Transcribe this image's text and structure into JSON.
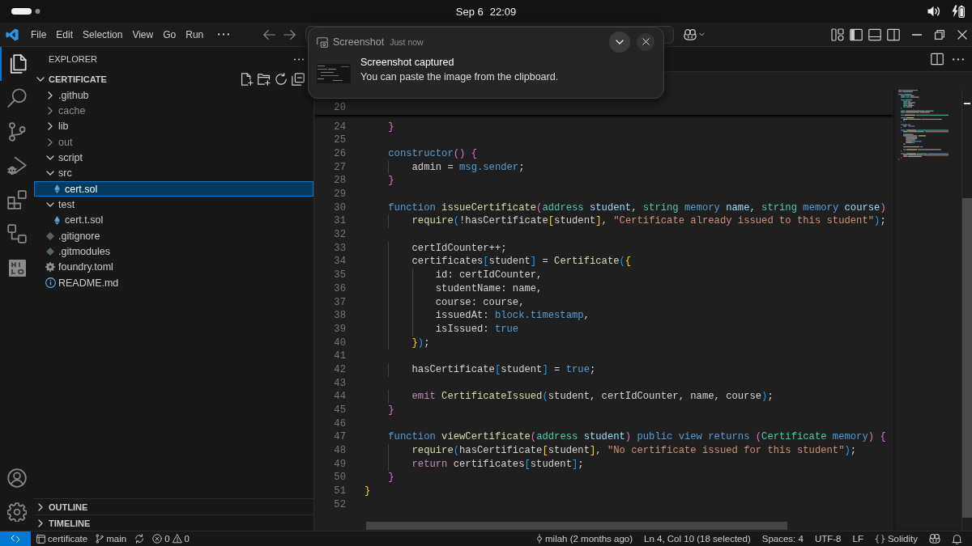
{
  "top_bar": {
    "date": "Sep 6",
    "time": "22:09"
  },
  "title_bar": {
    "menu": [
      "File",
      "Edit",
      "Selection",
      "View",
      "Go",
      "Run"
    ]
  },
  "activity_bar": {
    "items": [
      {
        "kind": "explorer",
        "selected": true
      },
      {
        "kind": "search",
        "selected": false
      },
      {
        "kind": "source-control",
        "selected": false
      },
      {
        "kind": "run-debug",
        "selected": false
      },
      {
        "kind": "extensions",
        "selected": false
      },
      {
        "kind": "remote",
        "selected": false
      },
      {
        "kind": "extension-tile",
        "selected": false
      }
    ],
    "bottom": [
      {
        "kind": "account"
      },
      {
        "kind": "settings"
      }
    ]
  },
  "explorer": {
    "title": "EXPLORER",
    "folder": {
      "name": "CERTIFICATE",
      "expanded": true,
      "children": [
        {
          "name": ".github",
          "kind": "folder",
          "expanded": false,
          "ignored": false,
          "selected": false
        },
        {
          "name": "cache",
          "kind": "folder",
          "expanded": false,
          "ignored": true,
          "selected": false
        },
        {
          "name": "lib",
          "kind": "folder",
          "expanded": false,
          "ignored": false,
          "selected": false
        },
        {
          "name": "out",
          "kind": "folder",
          "expanded": false,
          "ignored": true,
          "selected": false
        },
        {
          "name": "script",
          "kind": "folder",
          "expanded": true,
          "ignored": false,
          "selected": false
        },
        {
          "name": "src",
          "kind": "folder",
          "expanded": true,
          "ignored": false,
          "selected": false,
          "children": [
            {
              "name": "cert.sol",
              "kind": "solidity",
              "ignored": false,
              "selected": true
            }
          ]
        },
        {
          "name": "test",
          "kind": "folder",
          "expanded": true,
          "ignored": false,
          "selected": false,
          "children": [
            {
              "name": "cert.t.sol",
              "kind": "solidity",
              "ignored": false,
              "selected": false
            }
          ]
        },
        {
          "name": ".gitignore",
          "kind": "git",
          "ignored": false,
          "selected": false
        },
        {
          "name": ".gitmodules",
          "kind": "git",
          "ignored": false,
          "selected": false
        },
        {
          "name": "foundry.toml",
          "kind": "config",
          "ignored": false,
          "selected": false
        },
        {
          "name": "README.md",
          "kind": "info",
          "ignored": false,
          "selected": false
        }
      ]
    },
    "sections": [
      {
        "name": "OUTLINE",
        "expanded": false
      },
      {
        "name": "TIMELINE",
        "expanded": false
      }
    ]
  },
  "notification": {
    "app": "Screenshot",
    "time": "Just now",
    "title": "Screenshot captured",
    "body": "You can paste the image from the clipboard."
  },
  "editor": {
    "sticky_line": {
      "number": "20"
    },
    "lines": [
      {
        "number": "24",
        "tokens": [
          {
            "text": "    }",
            "kind": "b2"
          }
        ]
      },
      {
        "number": "25"
      },
      {
        "number": "26",
        "tokens": [
          {
            "text": "    constructor",
            "kind": "kw"
          },
          {
            "text": "()",
            "kind": "b2"
          },
          {
            "text": " {",
            "kind": "b2"
          }
        ]
      },
      {
        "number": "27",
        "tokens": [
          {
            "text": "        admin = ",
            "kind": "txt"
          },
          {
            "text": "msg.sender",
            "kind": "kw"
          },
          {
            "text": ";",
            "kind": "txt"
          }
        ]
      },
      {
        "number": "28",
        "tokens": [
          {
            "text": "    }",
            "kind": "b2"
          }
        ]
      },
      {
        "number": "29"
      },
      {
        "number": "30",
        "tokens": [
          {
            "text": "    function",
            "kind": "kw"
          },
          {
            "text": " issueCertificate",
            "kind": "fn"
          },
          {
            "text": "(",
            "kind": "b2"
          },
          {
            "text": "address",
            "kind": "type"
          },
          {
            "text": " student",
            "kind": "var"
          },
          {
            "text": ", ",
            "kind": "txt"
          },
          {
            "text": "string",
            "kind": "type"
          },
          {
            "text": " memory",
            "kind": "kw"
          },
          {
            "text": " name",
            "kind": "var"
          },
          {
            "text": ", ",
            "kind": "txt"
          },
          {
            "text": "string",
            "kind": "type"
          },
          {
            "text": " memory",
            "kind": "kw"
          },
          {
            "text": " course",
            "kind": "var"
          },
          {
            "text": ")",
            "kind": "b2"
          }
        ]
      },
      {
        "number": "31",
        "tokens": [
          {
            "text": "        require",
            "kind": "fn"
          },
          {
            "text": "(",
            "kind": "b3"
          },
          {
            "text": "!hasCertificate",
            "kind": "txt"
          },
          {
            "text": "[",
            "kind": "b1"
          },
          {
            "text": "student",
            "kind": "txt"
          },
          {
            "text": "]",
            "kind": "b1"
          },
          {
            "text": ", ",
            "kind": "txt"
          },
          {
            "text": "\"Certificate already issued to this student\"",
            "kind": "str"
          },
          {
            "text": ")",
            "kind": "b3"
          },
          {
            "text": ";",
            "kind": "txt"
          }
        ]
      },
      {
        "number": "32"
      },
      {
        "number": "33",
        "tokens": [
          {
            "text": "        certIdCounter++;",
            "kind": "txt"
          }
        ]
      },
      {
        "number": "34",
        "tokens": [
          {
            "text": "        certificates",
            "kind": "txt"
          },
          {
            "text": "[",
            "kind": "b3"
          },
          {
            "text": "student",
            "kind": "txt"
          },
          {
            "text": "]",
            "kind": "b3"
          },
          {
            "text": " = ",
            "kind": "txt"
          },
          {
            "text": "Certificate",
            "kind": "fn"
          },
          {
            "text": "(",
            "kind": "b3"
          },
          {
            "text": "{",
            "kind": "b1"
          }
        ]
      },
      {
        "number": "35",
        "tokens": [
          {
            "text": "            id: certIdCounter,",
            "kind": "txt"
          }
        ]
      },
      {
        "number": "36",
        "tokens": [
          {
            "text": "            studentName: name,",
            "kind": "txt"
          }
        ]
      },
      {
        "number": "37",
        "tokens": [
          {
            "text": "            course: course,",
            "kind": "txt"
          }
        ]
      },
      {
        "number": "38",
        "tokens": [
          {
            "text": "            issuedAt: ",
            "kind": "txt"
          },
          {
            "text": "block.timestamp",
            "kind": "kw"
          },
          {
            "text": ",",
            "kind": "txt"
          }
        ]
      },
      {
        "number": "39",
        "tokens": [
          {
            "text": "            isIssued: ",
            "kind": "txt"
          },
          {
            "text": "true",
            "kind": "kw"
          }
        ]
      },
      {
        "number": "40",
        "tokens": [
          {
            "text": "        }",
            "kind": "b1"
          },
          {
            "text": ")",
            "kind": "b3"
          },
          {
            "text": ";",
            "kind": "txt"
          }
        ]
      },
      {
        "number": "41"
      },
      {
        "number": "42",
        "tokens": [
          {
            "text": "        hasCertificate",
            "kind": "txt"
          },
          {
            "text": "[",
            "kind": "b3"
          },
          {
            "text": "student",
            "kind": "txt"
          },
          {
            "text": "]",
            "kind": "b3"
          },
          {
            "text": " = ",
            "kind": "txt"
          },
          {
            "text": "true",
            "kind": "kw"
          },
          {
            "text": ";",
            "kind": "txt"
          }
        ]
      },
      {
        "number": "43"
      },
      {
        "number": "44",
        "tokens": [
          {
            "text": "        emit",
            "kind": "ctl"
          },
          {
            "text": " CertificateIssued",
            "kind": "fn"
          },
          {
            "text": "(",
            "kind": "b3"
          },
          {
            "text": "student, certIdCounter, name, course",
            "kind": "txt"
          },
          {
            "text": ")",
            "kind": "b3"
          },
          {
            "text": ";",
            "kind": "txt"
          }
        ]
      },
      {
        "number": "45",
        "tokens": [
          {
            "text": "    }",
            "kind": "b2"
          }
        ]
      },
      {
        "number": "46"
      },
      {
        "number": "47",
        "tokens": [
          {
            "text": "    function",
            "kind": "kw"
          },
          {
            "text": " viewCertificate",
            "kind": "fn"
          },
          {
            "text": "(",
            "kind": "b2"
          },
          {
            "text": "address",
            "kind": "type"
          },
          {
            "text": " student",
            "kind": "var"
          },
          {
            "text": ")",
            "kind": "b2"
          },
          {
            "text": " public view returns",
            "kind": "kw"
          },
          {
            "text": " (",
            "kind": "b2"
          },
          {
            "text": "Certificate",
            "kind": "type"
          },
          {
            "text": " memory",
            "kind": "kw"
          },
          {
            "text": ")",
            "kind": "b2"
          },
          {
            "text": " {",
            "kind": "b2"
          }
        ]
      },
      {
        "number": "48",
        "tokens": [
          {
            "text": "        require",
            "kind": "fn"
          },
          {
            "text": "(",
            "kind": "b3"
          },
          {
            "text": "hasCertificate",
            "kind": "txt"
          },
          {
            "text": "[",
            "kind": "b1"
          },
          {
            "text": "student",
            "kind": "txt"
          },
          {
            "text": "]",
            "kind": "b1"
          },
          {
            "text": ", ",
            "kind": "txt"
          },
          {
            "text": "\"No certificate issued for this student\"",
            "kind": "str"
          },
          {
            "text": ")",
            "kind": "b3"
          },
          {
            "text": ";",
            "kind": "txt"
          }
        ]
      },
      {
        "number": "49",
        "tokens": [
          {
            "text": "        return",
            "kind": "ctl"
          },
          {
            "text": " certificates",
            "kind": "txt"
          },
          {
            "text": "[",
            "kind": "b3"
          },
          {
            "text": "student",
            "kind": "txt"
          },
          {
            "text": "]",
            "kind": "b3"
          },
          {
            "text": ";",
            "kind": "txt"
          }
        ]
      },
      {
        "number": "50",
        "tokens": [
          {
            "text": "    }",
            "kind": "b2"
          }
        ]
      },
      {
        "number": "51",
        "tokens": [
          {
            "text": "}",
            "kind": "b1"
          }
        ]
      },
      {
        "number": "52"
      }
    ]
  },
  "status_bar": {
    "left": [
      {
        "kind": "remote"
      },
      {
        "kind": "folder",
        "text": "certificate"
      },
      {
        "kind": "branch",
        "text": "main"
      },
      {
        "kind": "sync"
      },
      {
        "kind": "problems",
        "errors": "0",
        "warnings": "0"
      }
    ],
    "right": [
      {
        "kind": "blame",
        "text": "milah (2 months ago)"
      },
      {
        "kind": "text",
        "text": "Ln 4, Col 10 (18 selected)"
      },
      {
        "kind": "text",
        "text": "Spaces: 4"
      },
      {
        "kind": "text",
        "text": "UTF-8"
      },
      {
        "kind": "text",
        "text": "LF"
      },
      {
        "kind": "language",
        "text": "Solidity"
      },
      {
        "kind": "copilot"
      },
      {
        "kind": "bell"
      }
    ]
  }
}
